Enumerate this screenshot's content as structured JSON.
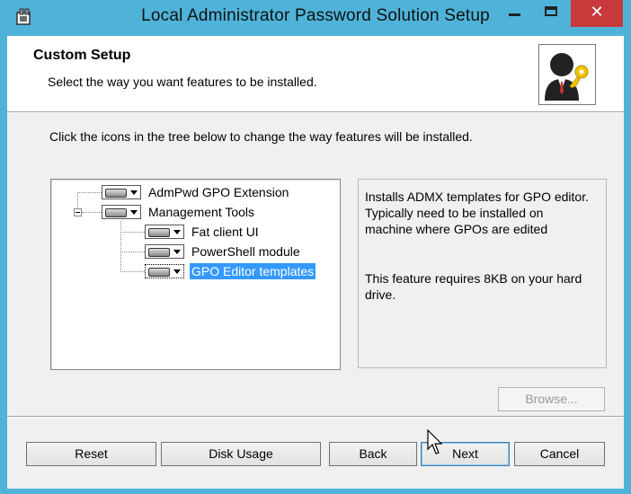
{
  "window": {
    "title": "Local Administrator Password Solution Setup",
    "close_glyph": "✕"
  },
  "header": {
    "title": "Custom Setup",
    "subtitle": "Select the way you want features to be installed."
  },
  "instruction": "Click the icons in the tree below to change the way features will be installed.",
  "tree": {
    "nodes": [
      {
        "label": "AdmPwd GPO Extension",
        "selected": false
      },
      {
        "label": "Management Tools",
        "selected": false
      },
      {
        "label": "Fat client UI",
        "selected": false
      },
      {
        "label": "PowerShell module",
        "selected": false
      },
      {
        "label": "GPO Editor templates",
        "selected": true
      }
    ]
  },
  "description": {
    "text": "Installs ADMX templates for GPO editor. Typically need to be installed on machine where GPOs are edited",
    "size_text": "This feature requires 8KB on your hard drive."
  },
  "buttons": {
    "browse": "Browse...",
    "reset": "Reset",
    "disk_usage": "Disk Usage",
    "back": "Back",
    "next": "Next",
    "cancel": "Cancel"
  },
  "colors": {
    "frame": "#4fb3d9",
    "close": "#c7393a",
    "selection": "#3399ff"
  }
}
